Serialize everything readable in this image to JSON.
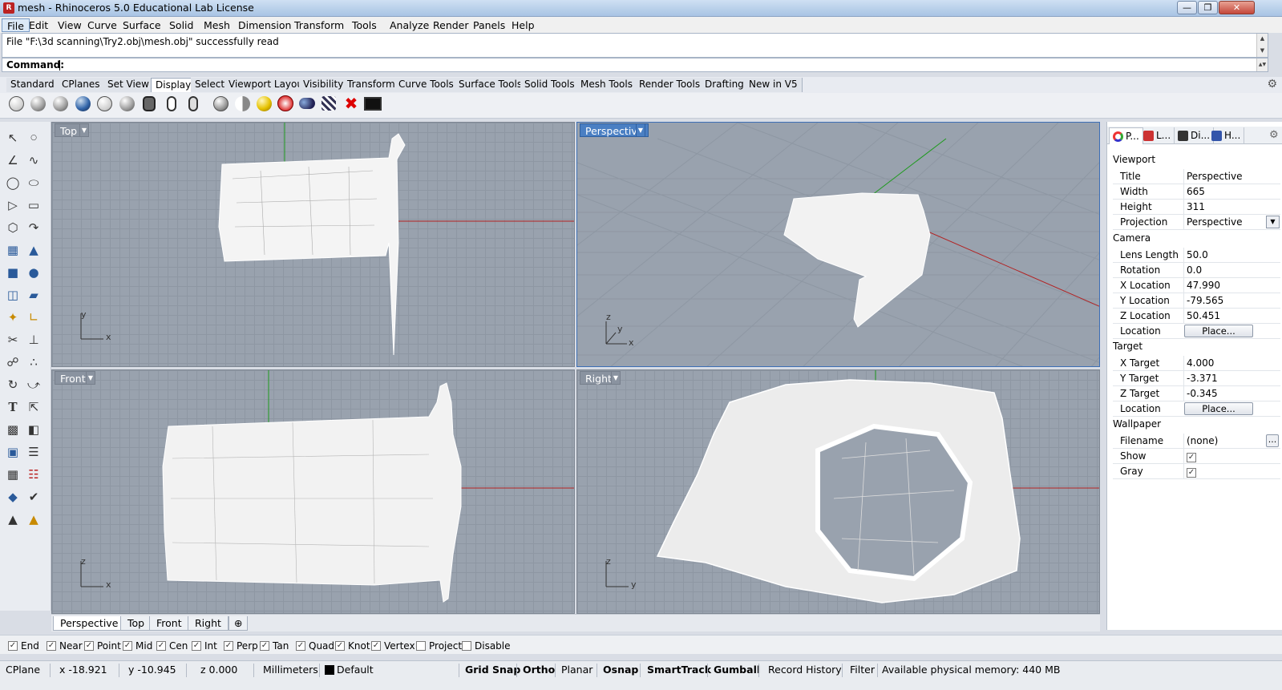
{
  "window": {
    "title": "mesh - Rhinoceros 5.0 Educational Lab License"
  },
  "menu": [
    "File",
    "Edit",
    "View",
    "Curve",
    "Surface",
    "Solid",
    "Mesh",
    "Dimension",
    "Transform",
    "Tools",
    "Analyze",
    "Render",
    "Panels",
    "Help"
  ],
  "history": {
    "line1": "File \"F:\\3d scanning\\Try2.obj\\mesh.obj\" successfully read"
  },
  "command": {
    "label": "Command:",
    "value": ""
  },
  "toolbar_tabs": [
    "Standard",
    "CPlanes",
    "Set View",
    "Display",
    "Select",
    "Viewport Layout",
    "Visibility",
    "Transform",
    "Curve Tools",
    "Surface Tools",
    "Solid Tools",
    "Mesh Tools",
    "Render Tools",
    "Drafting",
    "New in V5"
  ],
  "selected_toolbar_tab": "Display",
  "viewports": {
    "top": {
      "label": "Top",
      "axis1": "y",
      "axis2": "x"
    },
    "perspective": {
      "label": "Perspective",
      "axis0": "z",
      "axis1": "y",
      "axis2": "x"
    },
    "front": {
      "label": "Front",
      "axis1": "z",
      "axis2": "x"
    },
    "right": {
      "label": "Right",
      "axis1": "z",
      "axis2": "y"
    }
  },
  "viewport_tabs": [
    "Perspective",
    "Top",
    "Front",
    "Right"
  ],
  "osnap": [
    {
      "label": "End",
      "checked": true
    },
    {
      "label": "Near",
      "checked": true
    },
    {
      "label": "Point",
      "checked": true
    },
    {
      "label": "Mid",
      "checked": true
    },
    {
      "label": "Cen",
      "checked": true
    },
    {
      "label": "Int",
      "checked": true
    },
    {
      "label": "Perp",
      "checked": true
    },
    {
      "label": "Tan",
      "checked": true
    },
    {
      "label": "Quad",
      "checked": true
    },
    {
      "label": "Knot",
      "checked": true
    },
    {
      "label": "Vertex",
      "checked": true
    },
    {
      "label": "Project",
      "checked": false
    },
    {
      "label": "Disable",
      "checked": false
    }
  ],
  "status": {
    "cplane": "CPlane",
    "x": "x -18.921",
    "y": "y -10.945",
    "z": "z 0.000",
    "units": "Millimeters",
    "layer": "Default",
    "grid_snap": "Grid Snap",
    "ortho": "Ortho",
    "planar": "Planar",
    "osnap": "Osnap",
    "smarttrack": "SmartTrack",
    "gumball": "Gumball",
    "record_history": "Record History",
    "filter": "Filter",
    "memory": "Available physical memory: 440 MB"
  },
  "panel": {
    "tabs": [
      "P...",
      "L...",
      "Di...",
      "H..."
    ],
    "viewport_section": "Viewport",
    "title_label": "Title",
    "title_value": "Perspective",
    "width_label": "Width",
    "width_value": "665",
    "height_label": "Height",
    "height_value": "311",
    "projection_label": "Projection",
    "projection_value": "Perspective",
    "camera_section": "Camera",
    "lens_label": "Lens Length",
    "lens_value": "50.0",
    "rotation_label": "Rotation",
    "rotation_value": "0.0",
    "xloc_label": "X Location",
    "xloc_value": "47.990",
    "yloc_label": "Y Location",
    "yloc_value": "-79.565",
    "zloc_label": "Z Location",
    "zloc_value": "50.451",
    "location_label": "Location",
    "place_label": "Place...",
    "target_section": "Target",
    "xt_label": "X Target",
    "xt_value": "4.000",
    "yt_label": "Y Target",
    "yt_value": "-3.371",
    "zt_label": "Z Target",
    "zt_value": "-0.345",
    "tlocation_label": "Location",
    "tplace_label": "Place...",
    "wallpaper_section": "Wallpaper",
    "filename_label": "Filename",
    "filename_value": "(none)",
    "browse_label": "...",
    "show_label": "Show",
    "show_checked": true,
    "gray_label": "Gray",
    "gray_checked": true
  },
  "colors": {
    "active_viewport": "#4a7fc3",
    "x_axis": "#b22222",
    "y_axis": "#1f9a1f"
  }
}
